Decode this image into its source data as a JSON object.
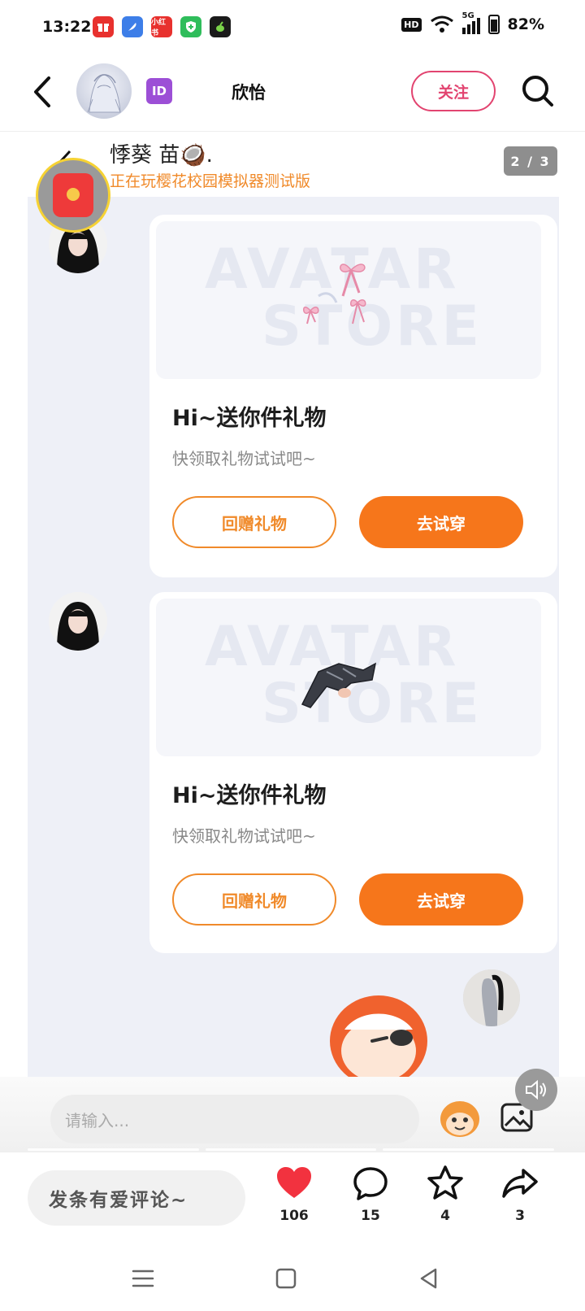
{
  "status_bar": {
    "time": "13:22",
    "network": "5G",
    "hd": "HD",
    "battery": "82%",
    "notification_apps": [
      {
        "icon": "gift-app-icon",
        "color": "#e8312e",
        "label": ""
      },
      {
        "icon": "feather-app-icon",
        "color": "#3d7ee8",
        "label": ""
      },
      {
        "icon": "xiaohongshu-app-icon",
        "color": "#e8312e",
        "label": "小红书"
      },
      {
        "icon": "shield-app-icon",
        "color": "#2fbd5b",
        "label": ""
      },
      {
        "icon": "plant-app-icon",
        "color": "#1a1a1a",
        "label": ""
      }
    ]
  },
  "header": {
    "back_icon": "chevron-left-icon",
    "id_badge": "ID",
    "author_name": "欣怡",
    "follow_label": "关注",
    "search_icon": "search-icon"
  },
  "post": {
    "overlay_name": "悸葵 苗🥥.",
    "overlay_status": "正在玩樱花校园模拟器测试版",
    "page_indicator": "2 / 3",
    "watermark_line1": "AVATAR",
    "watermark_line2": "STORE",
    "messages": [
      {
        "title": "Hi~送你件礼物",
        "subtitle": "快领取礼物试试吧~",
        "return_gift_label": "回赠礼物",
        "try_on_label": "去试穿",
        "item": "pink-bows"
      },
      {
        "title": "Hi~送你件礼物",
        "subtitle": "快领取礼物试试吧~",
        "return_gift_label": "回赠礼物",
        "try_on_label": "去试穿",
        "item": "black-jacket"
      }
    ]
  },
  "chat_input": {
    "placeholder": "请输入...",
    "emoji_icon": "emoji-icon",
    "image_icon": "image-icon",
    "sound_icon": "speaker-icon"
  },
  "actions": {
    "comment_placeholder": "发条有爱评论~",
    "like_count": "106",
    "comment_count": "15",
    "favorite_count": "4",
    "share_count": "3",
    "like_color": "#f2323f"
  },
  "colors": {
    "accent_pink": "#e24470",
    "accent_orange": "#f6761b"
  }
}
